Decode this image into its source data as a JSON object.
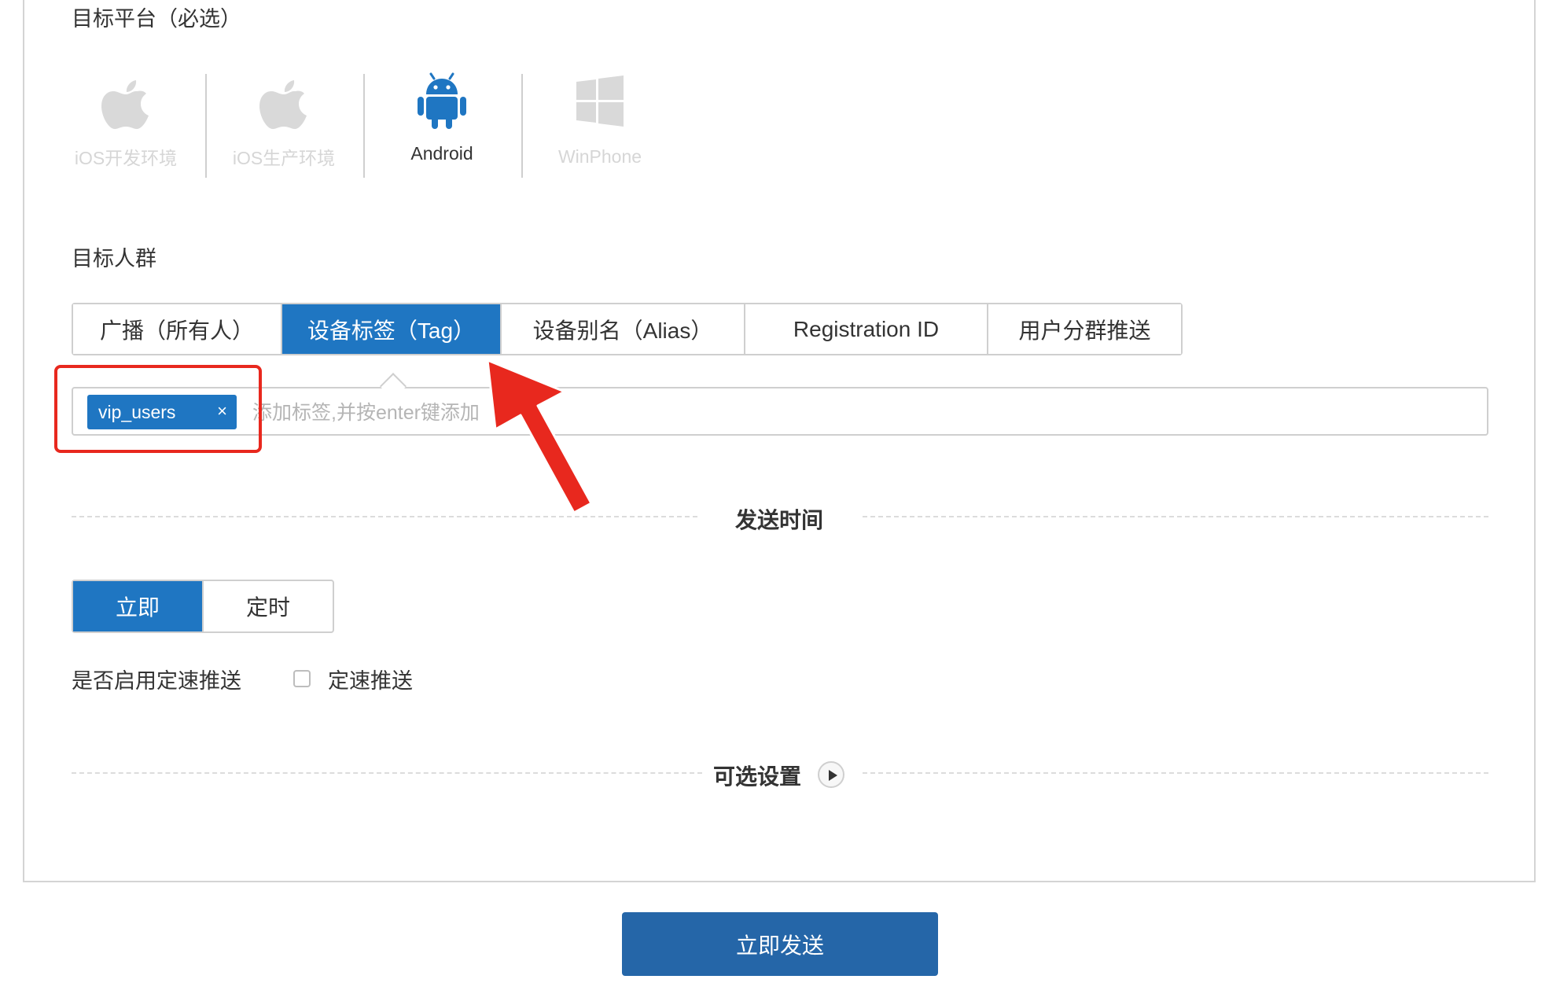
{
  "platform_section": {
    "title": "目标平台（必选）",
    "platforms": [
      {
        "label": "iOS开发环境",
        "icon": "apple-icon",
        "state": "disabled"
      },
      {
        "label": "iOS生产环境",
        "icon": "apple-icon",
        "state": "disabled"
      },
      {
        "label": "Android",
        "icon": "android-icon",
        "state": "active"
      },
      {
        "label": "WinPhone",
        "icon": "windows-icon",
        "state": "disabled"
      }
    ]
  },
  "audience_section": {
    "title": "目标人群",
    "tabs": [
      {
        "label": "广播（所有人）",
        "active": false
      },
      {
        "label": "设备标签（Tag）",
        "active": true
      },
      {
        "label": "设备别名（Alias）",
        "active": false
      },
      {
        "label": "Registration ID",
        "active": false
      },
      {
        "label": "用户分群推送",
        "active": false
      }
    ],
    "tag_input": {
      "tags": [
        "vip_users"
      ],
      "remove_glyph": "×",
      "placeholder": "添加标签,并按enter键添加"
    }
  },
  "send_time_section": {
    "title": "发送时间",
    "options": [
      {
        "label": "立即",
        "active": true
      },
      {
        "label": "定时",
        "active": false
      }
    ],
    "rate_limit_label": "是否启用定速推送",
    "rate_limit_checkbox_label": "定速推送",
    "rate_limit_checked": false
  },
  "optional_section": {
    "title": "可选设置"
  },
  "submit": {
    "label": "立即发送"
  },
  "colors": {
    "accent": "#1f76c2",
    "submit_bg": "#2566a8",
    "annotation_red": "#e8281e",
    "disabled_icon": "#d9d9d9"
  }
}
